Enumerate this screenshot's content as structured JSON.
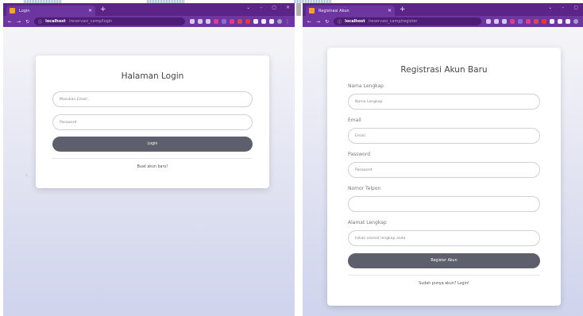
{
  "left_window": {
    "tab_title": "Login",
    "url_host": "localhost",
    "url_path": "/reservasi_camp/login",
    "page": {
      "title": "Halaman Login",
      "email_placeholder": "Masukan Email...",
      "password_placeholder": "Password",
      "login_label": "Login",
      "register_link": "Buat akun baru!"
    }
  },
  "right_window": {
    "tab_title": "Registrasi Akun",
    "url_host": "localhost",
    "url_path": "/reservasi_camp/register",
    "page": {
      "title": "Registrasi Akun Baru",
      "fields": [
        {
          "label": "Nama Lengkap",
          "placeholder": "Nama Lengkap"
        },
        {
          "label": "Email",
          "placeholder": "Email"
        },
        {
          "label": "Password",
          "placeholder": "Password"
        },
        {
          "label": "Nomor Telpon",
          "placeholder": ""
        },
        {
          "label": "Alamat Lengkap",
          "placeholder": "Isikan alamat lengkap anda"
        }
      ],
      "register_label": "Register Akun",
      "login_link": "Sudah punya akun? Login!"
    }
  },
  "colors": {
    "browser_frame": "#6b2f9a",
    "button_dark": "#5d5f6c"
  }
}
